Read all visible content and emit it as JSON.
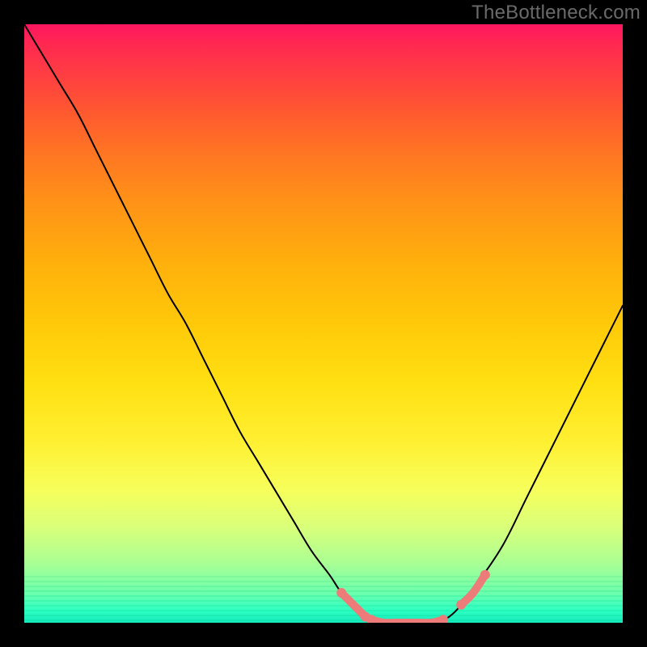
{
  "watermark": "TheBottleneck.com",
  "colors": {
    "frame": "#000000",
    "watermark_text": "#6a6a6a",
    "curve": "#000000",
    "salmon": "#ed7b79"
  },
  "chart_data": {
    "type": "line",
    "title": "",
    "xlabel": "",
    "ylabel": "",
    "xlim": [
      0,
      100
    ],
    "ylim": [
      0,
      100
    ],
    "x": [
      0,
      3,
      6,
      9,
      12,
      15,
      18,
      21,
      24,
      27,
      30,
      33,
      36,
      39,
      42,
      45,
      48,
      51,
      53,
      55,
      57,
      59,
      61,
      63,
      65,
      67,
      69,
      71,
      73,
      76,
      80,
      84,
      88,
      92,
      96,
      100
    ],
    "y": [
      100,
      95,
      90,
      85,
      79,
      73,
      67,
      61,
      55,
      50,
      44,
      38,
      32,
      27,
      22,
      17,
      12,
      8,
      5,
      3,
      1,
      0,
      0,
      0,
      0,
      0,
      0,
      1,
      3,
      7,
      13,
      21,
      29,
      37,
      45,
      53
    ],
    "salmon_segments": [
      {
        "x": [
          53,
          55,
          57
        ],
        "y": [
          5,
          3,
          1
        ]
      },
      {
        "x": [
          58,
          60,
          62,
          64,
          66,
          68,
          70
        ],
        "y": [
          0.5,
          0,
          0,
          0,
          0,
          0,
          0.5
        ]
      },
      {
        "x": [
          73,
          75,
          77
        ],
        "y": [
          3,
          5,
          8
        ]
      }
    ]
  }
}
